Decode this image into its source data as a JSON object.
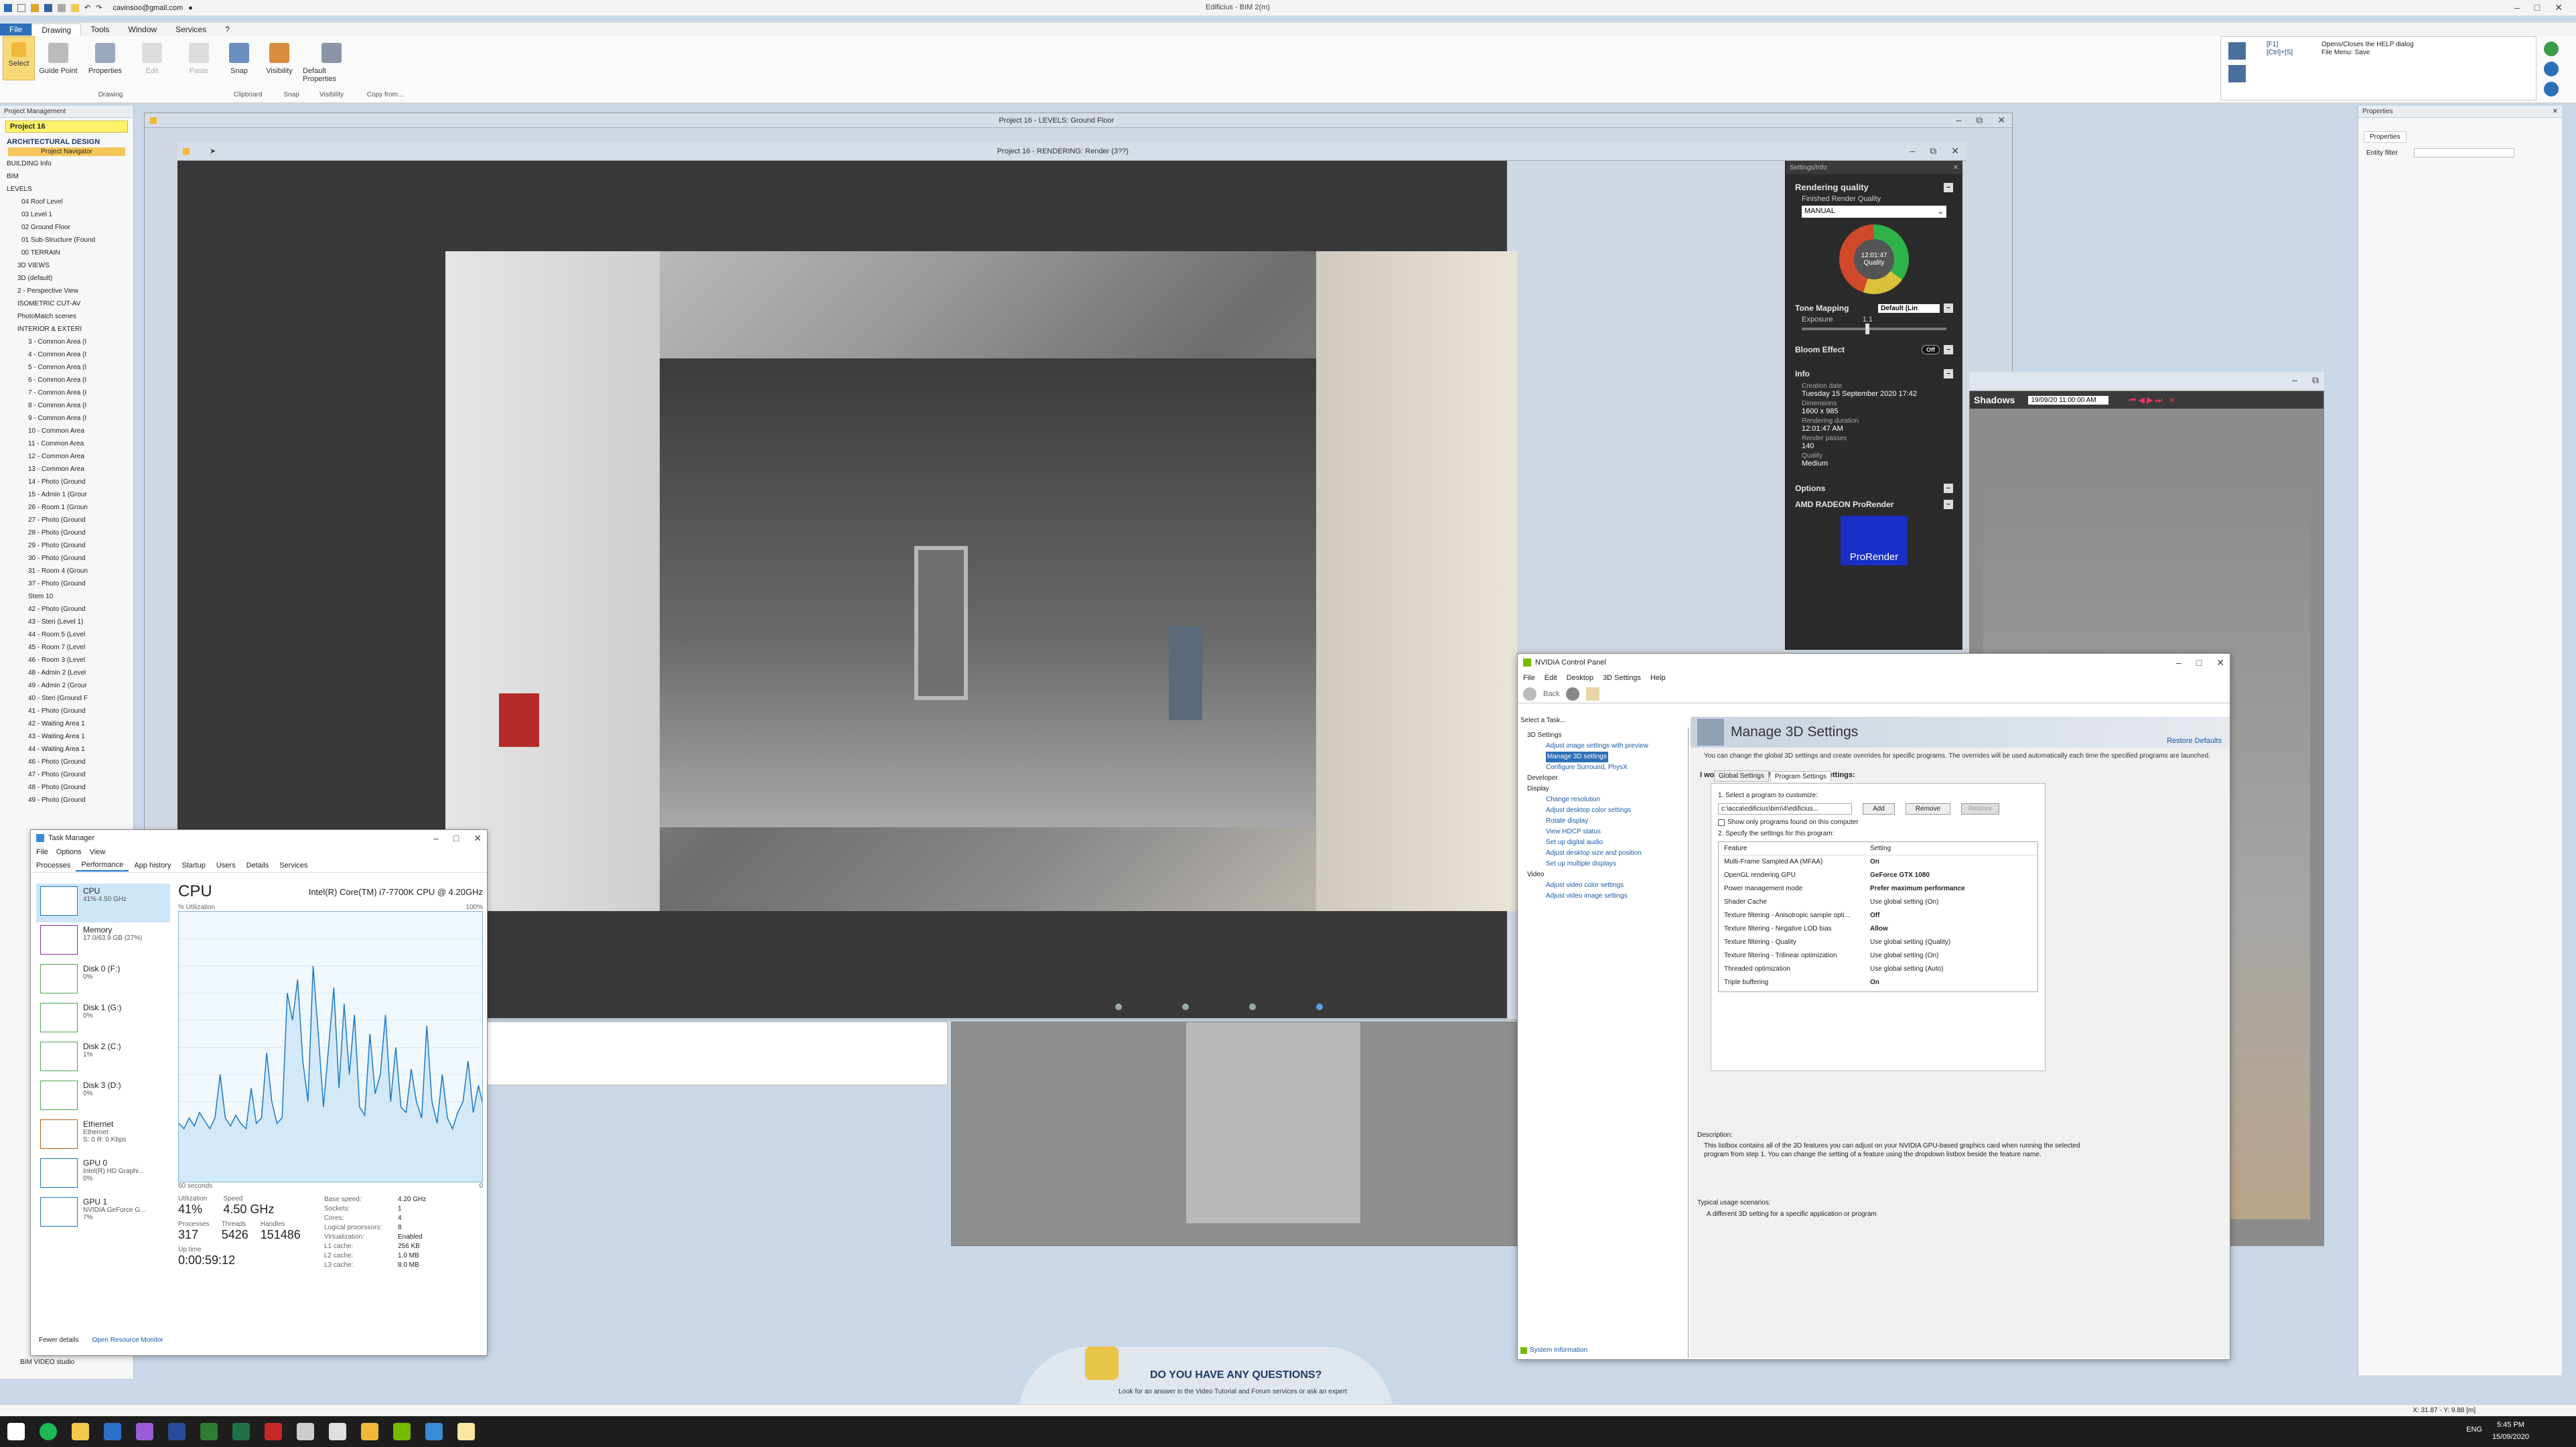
{
  "app": {
    "title": "Edificius - BIM 2(m)",
    "user_email": "cavinsoo@gmail.com",
    "menu_tabs": [
      "File",
      "Drawing",
      "Tools",
      "Window",
      "Services",
      "?"
    ],
    "active_tab": "Drawing"
  },
  "ribbon": {
    "buttons": [
      "Select",
      "Guide Point",
      "Properties",
      "Edit",
      "Paste",
      "Snap",
      "Visibility",
      "Default Properties"
    ],
    "groups": [
      "Drawing",
      "Clipboard",
      "Snap",
      "Visibility",
      "Copy from..."
    ],
    "help_shortcuts": [
      "[F1]",
      "[Ctrl]+[S]"
    ],
    "help_texts": [
      "Opens/Closes the HELP dialog",
      "File Menu: Save"
    ]
  },
  "project_panel": {
    "header": "Project Management",
    "project_name": "Project 16",
    "discipline": "ARCHITECTURAL DESIGN",
    "navigator_label": "Project Navigator",
    "tree": [
      "BUILDING Info",
      "BIM",
      "LEVELS",
      "04 Roof Level",
      "03 Level 1",
      "02 Ground Floor",
      "01 Sub-Structure (Found",
      "00 TERRAIN",
      "3D VIEWS",
      "3D (default)",
      "2 - Perspective View",
      "ISOMETRIC CUT-AV",
      "PhotoMatch scenes",
      "INTERIOR & EXTERI",
      "3 - Common Area (I",
      "4 - Common Area (I",
      "5 - Common Area (I",
      "6 - Common Area (I",
      "7 - Common Area (I",
      "8 - Common Area (I",
      "9 - Common Area (I",
      "10 - Common Area",
      "11 - Common Area",
      "12 - Common Area",
      "13 - Common Area",
      "14 - Photo (Ground",
      "15 - Admin 1 (Grour",
      "26 - Room 1 (Groun",
      "27 - Photo (Ground",
      "28 - Photo (Ground",
      "29 - Photo (Ground",
      "30 - Photo (Ground",
      "31 - Room 4 (Groun",
      "37 - Photo (Ground",
      "Stem 10",
      "42 - Photo (Ground",
      "43 - Steri (Level 1)",
      "44 - Room 5 (Level",
      "45 - Room 7 (Level",
      "46 - Room 3 (Level",
      "48 - Admin 2 (Level",
      "49 - Admin 2 (Grour",
      "40 - Steri (Ground F",
      "41 - Photo (Ground",
      "42 - Waiting Area 1",
      "43 - Waiting Area 1",
      "44 - Waiting Area 1",
      "46 - Photo (Ground",
      "47 - Photo (Ground",
      "48 - Photo (Ground",
      "49 - Photo (Ground"
    ],
    "video_label": "BIM VIDEO studio"
  },
  "viewports": {
    "levels_title": "Project 16 - LEVELS: Ground Floor",
    "render_title": "Project 16 - RENDERING: Render (3??)"
  },
  "render_settings": {
    "header": "Settings/Info",
    "rendering_quality": "Rendering quality",
    "finished_quality_label": "Finished Render Quality",
    "quality_mode": "MANUAL",
    "gauge_time": "12:01:47",
    "gauge_label": "Quality",
    "tone_mapping": "Tone Mapping",
    "tone_mapping_value": "Default (Lin",
    "exposure_label": "Exposure",
    "exposure_value": "1.1",
    "bloom_label": "Bloom Effect",
    "bloom_value": "Off",
    "info_label": "Info",
    "info": [
      {
        "k": "Creation date",
        "v": "Tuesday 15 September 2020 17:42"
      },
      {
        "k": "Dimensions",
        "v": "1600 x 985"
      },
      {
        "k": "Rendering duration",
        "v": "12:01:47 AM"
      },
      {
        "k": "Render passes",
        "v": "140"
      },
      {
        "k": "Quality",
        "v": "Medium"
      }
    ],
    "options_label": "Options",
    "amd_label": "AMD RADEON ProRender",
    "amd_logo_text": "ProRender"
  },
  "shadows": {
    "label": "Shadows",
    "datetime": "19/09/20 11:00:00 AM"
  },
  "properties_panel": {
    "header": "Properties",
    "tab": "Properties",
    "filter_label": "Entity filter"
  },
  "task_manager": {
    "title": "Task Manager",
    "menu": [
      "File",
      "Options",
      "View"
    ],
    "tabs": [
      "Processes",
      "Performance",
      "App history",
      "Startup",
      "Users",
      "Details",
      "Services"
    ],
    "active_tab": "Performance",
    "items": [
      {
        "name": "CPU",
        "sub": "41%  4.50 GHz"
      },
      {
        "name": "Memory",
        "sub": "17.0/63.9 GB (27%)"
      },
      {
        "name": "Disk 0 (F:)",
        "sub": "0%"
      },
      {
        "name": "Disk 1 (G:)",
        "sub": "0%"
      },
      {
        "name": "Disk 2 (C:)",
        "sub": "1%"
      },
      {
        "name": "Disk 3 (D:)",
        "sub": "0%"
      },
      {
        "name": "Ethernet",
        "sub": "Ethernet\nS: 0  R: 0 Kbps"
      },
      {
        "name": "GPU 0",
        "sub": "Intel(R) HD Graphi...\n0%"
      },
      {
        "name": "GPU 1",
        "sub": "NVIDIA GeForce G...\n7%"
      }
    ],
    "cpu_heading": "CPU",
    "cpu_model": "Intel(R) Core(TM) i7-7700K CPU @ 4.20GHz",
    "util_label": "% Utilization",
    "util_max": "100%",
    "graph_left": "60 seconds",
    "graph_right": "0",
    "stats": {
      "utilization_label": "Utilization",
      "utilization": "41%",
      "speed_label": "Speed",
      "speed": "4.50 GHz",
      "processes_label": "Processes",
      "processes": "317",
      "threads_label": "Threads",
      "threads": "5426",
      "handles_label": "Handles",
      "handles": "151486",
      "uptime_label": "Up time",
      "uptime": "0:00:59:12"
    },
    "details": [
      {
        "k": "Base speed:",
        "v": "4.20 GHz"
      },
      {
        "k": "Sockets:",
        "v": "1"
      },
      {
        "k": "Cores:",
        "v": "4"
      },
      {
        "k": "Logical processors:",
        "v": "8"
      },
      {
        "k": "Virtualization:",
        "v": "Enabled"
      },
      {
        "k": "L1 cache:",
        "v": "256 KB"
      },
      {
        "k": "L2 cache:",
        "v": "1.0 MB"
      },
      {
        "k": "L3 cache:",
        "v": "8.0 MB"
      }
    ],
    "fewer_details": "Fewer details",
    "open_monitor": "Open Resource Monitor",
    "cpu_history": [
      22,
      20,
      24,
      21,
      26,
      23,
      20,
      24,
      40,
      24,
      21,
      25,
      22,
      20,
      35,
      22,
      24,
      48,
      30,
      22,
      24,
      70,
      60,
      75,
      45,
      30,
      80,
      55,
      28,
      50,
      72,
      35,
      66,
      40,
      62,
      28,
      25,
      55,
      33,
      40,
      62,
      30,
      50,
      28,
      26,
      42,
      30,
      24,
      58,
      30,
      22,
      40,
      24,
      20,
      26,
      30,
      45,
      26,
      36,
      28
    ]
  },
  "nvidia": {
    "title": "NVIDIA Control Panel",
    "menu": [
      "File",
      "Edit",
      "Desktop",
      "3D Settings",
      "Help"
    ],
    "back_label": "Back",
    "select_task": "Select a Task...",
    "tree": [
      {
        "type": "cat",
        "label": "3D Settings"
      },
      {
        "type": "link",
        "label": "Adjust image settings with preview"
      },
      {
        "type": "link",
        "label": "Manage 3D settings",
        "selected": true
      },
      {
        "type": "link",
        "label": "Configure Surround, PhysX"
      },
      {
        "type": "cat",
        "label": "Developer"
      },
      {
        "type": "cat",
        "label": "Display"
      },
      {
        "type": "link",
        "label": "Change resolution"
      },
      {
        "type": "link",
        "label": "Adjust desktop color settings"
      },
      {
        "type": "link",
        "label": "Rotate display"
      },
      {
        "type": "link",
        "label": "View HDCP status"
      },
      {
        "type": "link",
        "label": "Set up digital audio"
      },
      {
        "type": "link",
        "label": "Adjust desktop size and position"
      },
      {
        "type": "link",
        "label": "Set up multiple displays"
      },
      {
        "type": "cat",
        "label": "Video"
      },
      {
        "type": "link",
        "label": "Adjust video color settings"
      },
      {
        "type": "link",
        "label": "Adjust video image settings"
      }
    ],
    "heading": "Manage 3D Settings",
    "restore": "Restore Defaults",
    "intro": "You can change the global 3D settings and create overrides for specific programs. The overrides will be used automatically each time the specified programs are launched.",
    "use_following": "I would like to use the following 3D settings:",
    "tab_global": "Global Settings",
    "tab_program": "Program Settings",
    "step1": "1. Select a program to customize:",
    "program_path": "c:\\acca\\edificius\\bim\\4\\edificius...",
    "add": "Add",
    "remove": "Remove",
    "restore_btn": "Restore",
    "show_only": "Show only programs found on this computer",
    "step2": "2. Specify the settings for this program:",
    "col_feature": "Feature",
    "col_setting": "Setting",
    "rows": [
      {
        "f": "Multi-Frame Sampled AA (MFAA)",
        "s": "On"
      },
      {
        "f": "OpenGL rendering GPU",
        "s": "GeForce GTX 1080"
      },
      {
        "f": "Power management mode",
        "s": "Prefer maximum performance"
      },
      {
        "f": "Shader Cache",
        "s": "Use global setting (On)"
      },
      {
        "f": "Texture filtering - Anisotropic sample opti...",
        "s": "Off"
      },
      {
        "f": "Texture filtering - Negative LOD bias",
        "s": "Allow"
      },
      {
        "f": "Texture filtering - Quality",
        "s": "Use global setting (Quality)"
      },
      {
        "f": "Texture filtering - Trilinear optimization",
        "s": "Use global setting (On)"
      },
      {
        "f": "Threaded optimization",
        "s": "Use global setting (Auto)"
      },
      {
        "f": "Triple buffering",
        "s": "On"
      }
    ],
    "description_label": "Description:",
    "description": "This listbox contains all of the 3D features you can adjust on your NVIDIA GPU-based graphics card when running the selected program from step 1. You can change the setting of a feature using the dropdown listbox beside the feature name.",
    "usage_label": "Typical usage scenarios:",
    "usage": "A different 3D setting for a specific application or program",
    "system_info": "System Information"
  },
  "footer": {
    "questions": "DO YOU HAVE ANY QUESTIONS?",
    "questions_sub": "Look for an answer in the Video Tutorial and Forum services or ask an expert",
    "coords": "X: 31.87 - Y: 9.88 [m]",
    "lang": "ENG",
    "time": "5:45 PM",
    "date": "15/09/2020"
  }
}
